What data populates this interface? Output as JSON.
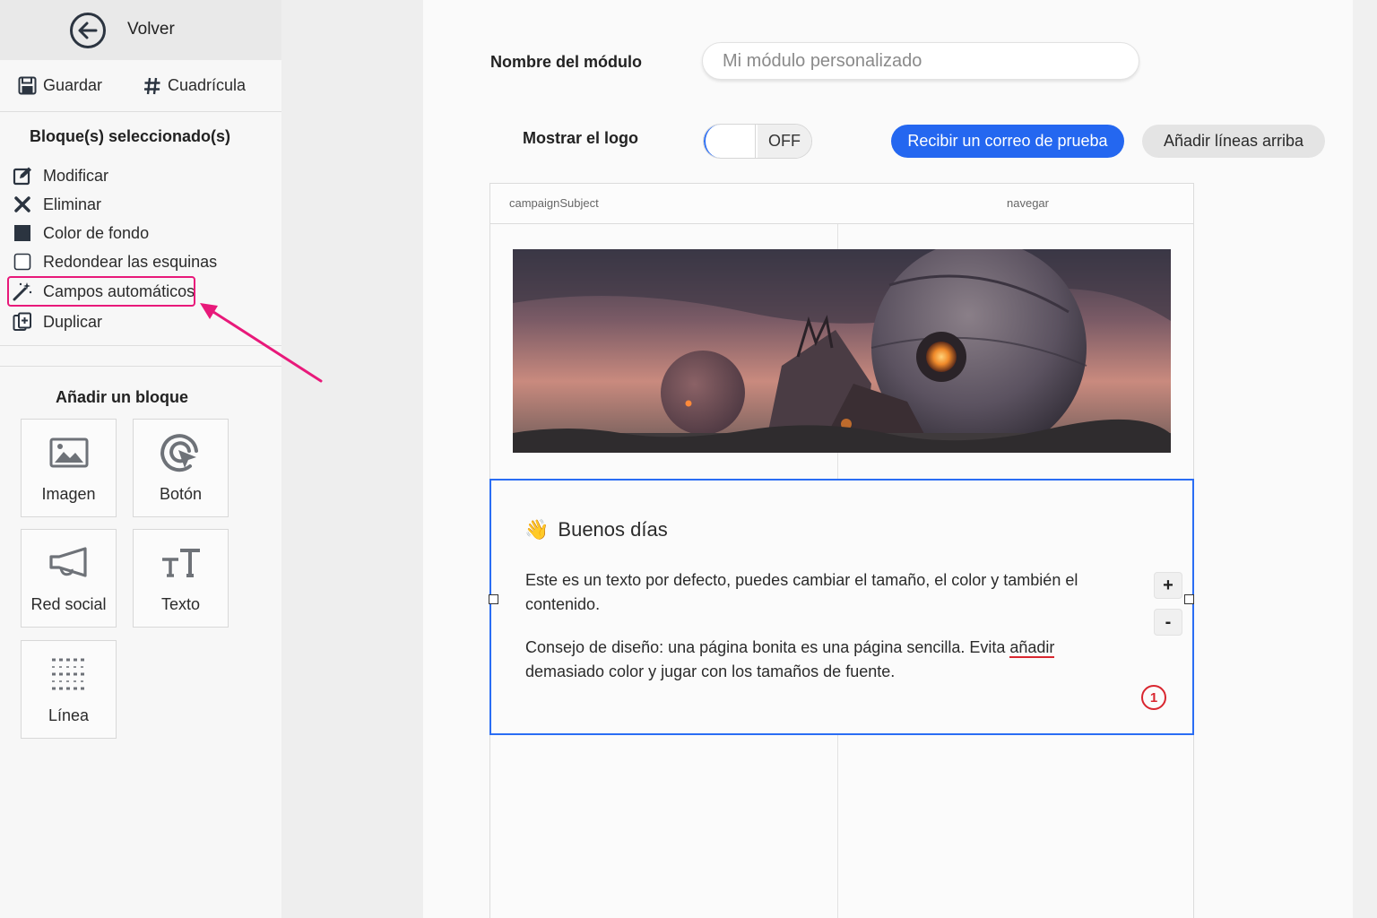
{
  "sidebar": {
    "back_label": "Volver",
    "save_label": "Guardar",
    "grid_label": "Cuadrícula",
    "selected_title": "Bloque(s) seleccionado(s)",
    "menu": {
      "modify": "Modificar",
      "delete": "Eliminar",
      "bg_color": "Color de fondo",
      "round_corners": "Redondear las esquinas",
      "auto_fields": "Campos automáticos",
      "duplicate": "Duplicar"
    },
    "add_block_title": "Añadir un bloque",
    "blocks": {
      "image": "Imagen",
      "button": "Botón",
      "social": "Red social",
      "text": "Texto",
      "line": "Línea"
    }
  },
  "form": {
    "module_name_label": "Nombre del módulo",
    "module_name_placeholder": "Mi módulo personalizado",
    "show_logo_label": "Mostrar el logo",
    "toggle_state": "OFF",
    "test_email_button": "Recibir un correo de prueba",
    "add_lines_button": "Añadir líneas arriba"
  },
  "email": {
    "subject_placeholder": "campaignSubject",
    "browse_link": "navegar",
    "greeting_emoji": "👋",
    "greeting": "Buenos días",
    "paragraph1": "Este es un texto por defecto, puedes cambiar el tamaño, el color y también el contenido.",
    "paragraph2_before": "Consejo de diseño: una página bonita es una página sencilla. Evita ",
    "paragraph2_underlined": "añadir",
    "paragraph2_after": " demasiado color y jugar con los tamaños de fuente.",
    "increase_label": "+",
    "decrease_label": "-",
    "marker_number": "1"
  },
  "colors": {
    "accent_blue": "#2467f0",
    "highlight_pink": "#e8197a",
    "marker_red": "#d9262f"
  }
}
